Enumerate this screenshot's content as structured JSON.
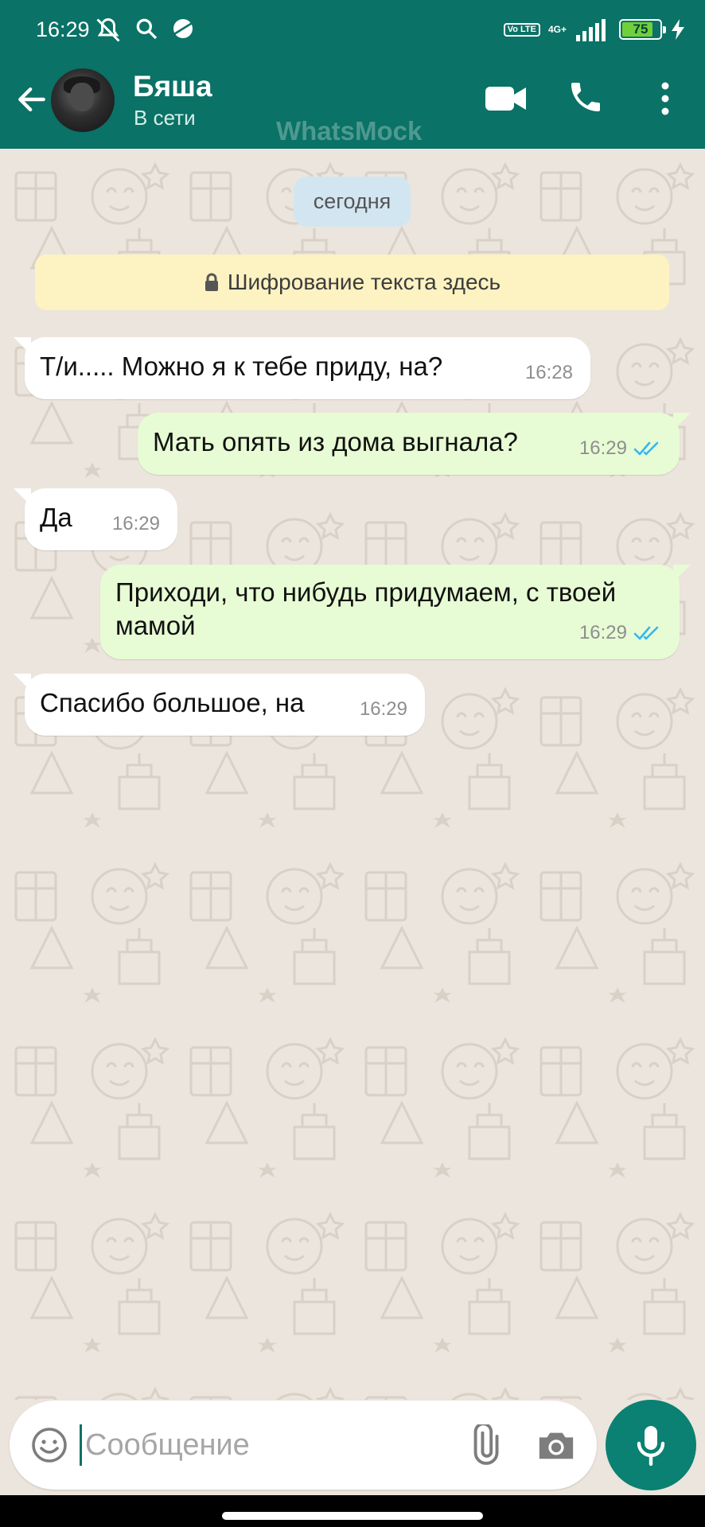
{
  "status_bar": {
    "time": "16:29",
    "lte_label": "Vo LTE",
    "network_label": "4G+",
    "battery_level": "75"
  },
  "header": {
    "contact_name": "Бяша",
    "contact_status": "В сети",
    "watermark": "WhatsMock",
    "accent_color": "#0a7266"
  },
  "chat": {
    "date_chip": "сегодня",
    "encryption_notice": "Шифрование текста здесь",
    "messages": [
      {
        "direction": "incoming",
        "text": "Т/и..... Можно я к тебе приду, на?",
        "time": "16:28"
      },
      {
        "direction": "outgoing",
        "text": "Мать опять из дома выгнала?",
        "time": "16:29",
        "status": "read"
      },
      {
        "direction": "incoming",
        "text": "Да",
        "time": "16:29"
      },
      {
        "direction": "outgoing",
        "text_line1": "Приходи, что нибудь придумаем, с твоей",
        "text_line2": "мамой",
        "time": "16:29",
        "status": "read"
      },
      {
        "direction": "incoming",
        "text": "Спасибо большое, на",
        "time": "16:29"
      }
    ]
  },
  "composer": {
    "placeholder": "Сообщение",
    "icons": [
      "emoji-icon",
      "paperclip-icon",
      "camera-icon",
      "microphone-icon"
    ]
  }
}
